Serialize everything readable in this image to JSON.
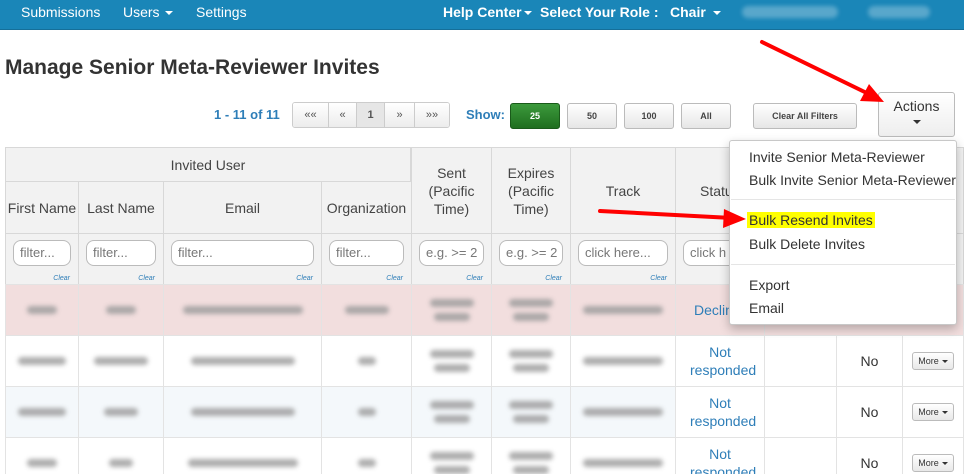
{
  "nav": {
    "submissions": "Submissions",
    "users": "Users",
    "settings": "Settings",
    "help_center": "Help Center",
    "select_role_label": "Select Your Role :",
    "role": "Chair"
  },
  "page": {
    "title": "Manage Senior Meta-Reviewer Invites"
  },
  "pager": {
    "info": "1 - 11 of 11",
    "first": "««",
    "prev": "«",
    "current": "1",
    "next": "»",
    "last": "»»",
    "show_label": "Show:",
    "sizes": [
      "25",
      "50",
      "100",
      "All"
    ],
    "selected_size": "25"
  },
  "toolbar": {
    "clear_filters": "Clear All Filters",
    "actions": "Actions"
  },
  "table": {
    "group_header": "Invited User",
    "columns": {
      "first_name": "First Name",
      "last_name": "Last Name",
      "email": "Email",
      "organization": "Organization",
      "sent": "Sent (Pacific Time)",
      "expires": "Expires (Pacific Time)",
      "track": "Track",
      "status": "Status"
    },
    "filters": {
      "first_name": "filter...",
      "last_name": "filter...",
      "email": "filter...",
      "organization": "filter...",
      "sent": "e.g. >= 2",
      "expires": "e.g. >= 2",
      "track": "click here...",
      "status": "click h",
      "clear": "Clear"
    },
    "rows": [
      {
        "status": "Declin",
        "extra": "",
        "more": ""
      },
      {
        "status": "Not responded",
        "extra": "No",
        "more": "More"
      },
      {
        "status": "Not responded",
        "extra": "No",
        "more": "More"
      },
      {
        "status": "Not responded",
        "extra": "No",
        "more": "More"
      }
    ]
  },
  "actions_menu": {
    "items": [
      "Invite Senior Meta-Reviewer",
      "Bulk Invite Senior Meta-Reviewer",
      "Bulk Resend Invites",
      "Bulk Delete Invites",
      "Export",
      "Email"
    ],
    "highlighted": "Bulk Resend Invites"
  },
  "colors": {
    "navbar": "#1a86b8",
    "link": "#2e7eb8",
    "primary_button": "#2a862a",
    "declined_row": "#f2dede",
    "highlight": "#ffff00",
    "arrow": "#ff0000"
  }
}
